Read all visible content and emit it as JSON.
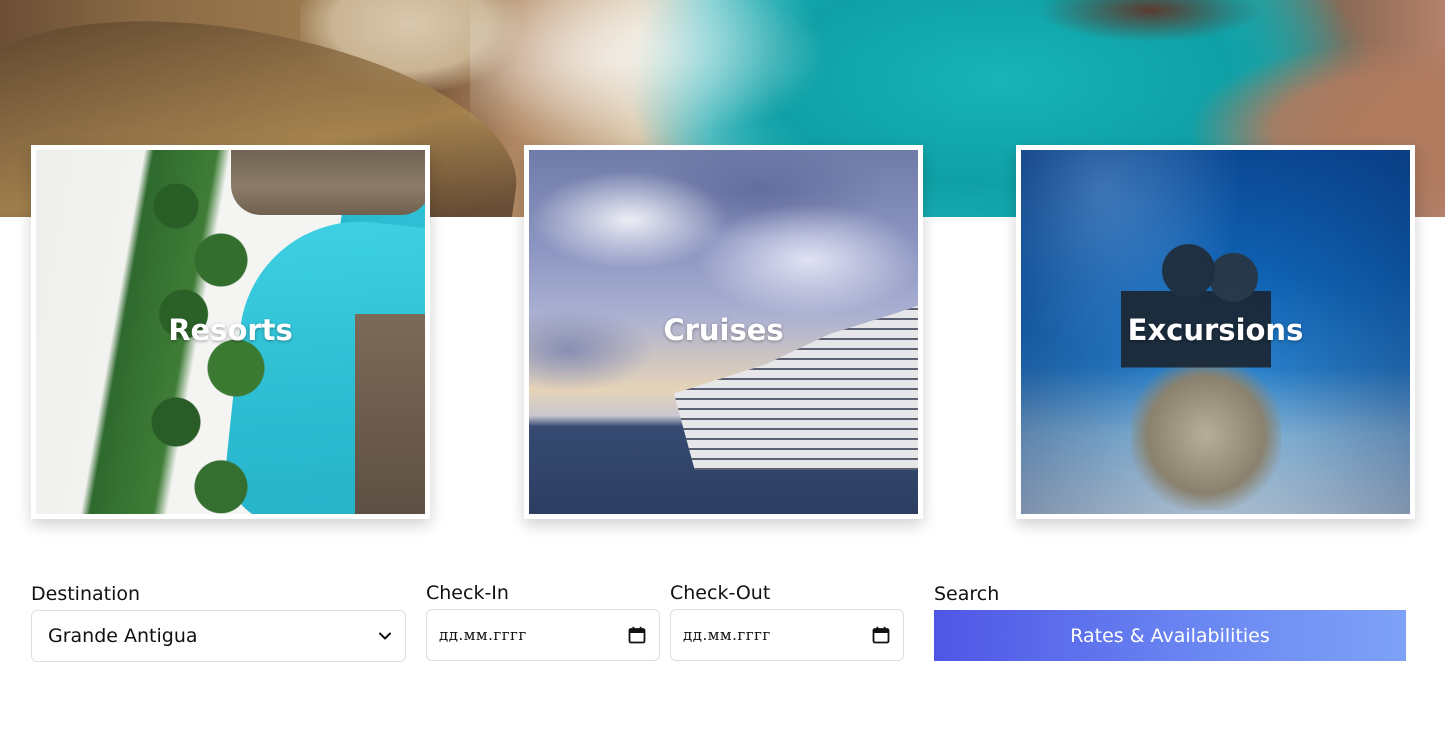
{
  "categories": [
    {
      "label": "Resorts"
    },
    {
      "label": "Cruises"
    },
    {
      "label": "Excursions"
    }
  ],
  "form": {
    "destination": {
      "label": "Destination",
      "selected": "Grande Antigua",
      "icon": "chevron-down-icon"
    },
    "check_in": {
      "label": "Check-In",
      "placeholder": "дд.мм.гггг",
      "icon": "calendar-icon"
    },
    "check_out": {
      "label": "Check-Out",
      "placeholder": "дд.мм.гггг",
      "icon": "calendar-icon"
    },
    "search": {
      "label": "Search",
      "button_label": "Rates & Availabilities"
    }
  },
  "colors": {
    "button_gradient_start": "#4f56e6",
    "button_gradient_end": "#7ea2f7",
    "card_label": "#ffffff"
  }
}
